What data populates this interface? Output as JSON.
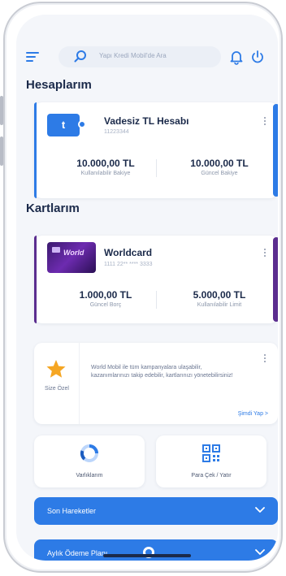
{
  "header": {
    "search_placeholder": "Yapı Kredi Mobil'de Ara",
    "menu_icon": "menu-icon",
    "search_icon": "search-icon",
    "notification_icon": "bell-icon",
    "logout_icon": "power-icon"
  },
  "accounts": {
    "title": "Hesaplarım",
    "card": {
      "name": "Vadesiz TL Hesabı",
      "number": "11223344",
      "logo_letter": "t",
      "left_amount": {
        "value": "10.000,00 TL",
        "label": "Kullanılabilir Bakiye"
      },
      "right_amount": {
        "value": "10.000,00 TL",
        "label": "Güncel Bakiye"
      }
    }
  },
  "cards": {
    "title": "Kartlarım",
    "card": {
      "name": "Worldcard",
      "number": "1111 22** **** 3333",
      "brand_text": "World",
      "left_amount": {
        "value": "1.000,00 TL",
        "label": "Güncel Borç"
      },
      "right_amount": {
        "value": "5.000,00 TL",
        "label": "Kullanılabilir Limit"
      }
    }
  },
  "promo": {
    "label": "Size Özel",
    "text": "World Mobil ile tüm kampanyalara ulaşabilir, kazanımlarınızı takip edebilir, kartlarınızı yönetebilirsiniz!",
    "link": "Şimdi Yap >"
  },
  "quick_actions": [
    {
      "label": "Varlıklarım",
      "icon": "pie-chart-icon"
    },
    {
      "label": "Para Çek / Yatır",
      "icon": "qr-code-icon"
    }
  ],
  "accordions": [
    {
      "label": "Son Hareketler"
    },
    {
      "label": "Aylık Ödeme Planı"
    }
  ],
  "colors": {
    "primary": "#2d7be6",
    "card_accent_purple": "#5b2d8f",
    "text_dark": "#1b2a4a",
    "star": "#f5a623"
  }
}
